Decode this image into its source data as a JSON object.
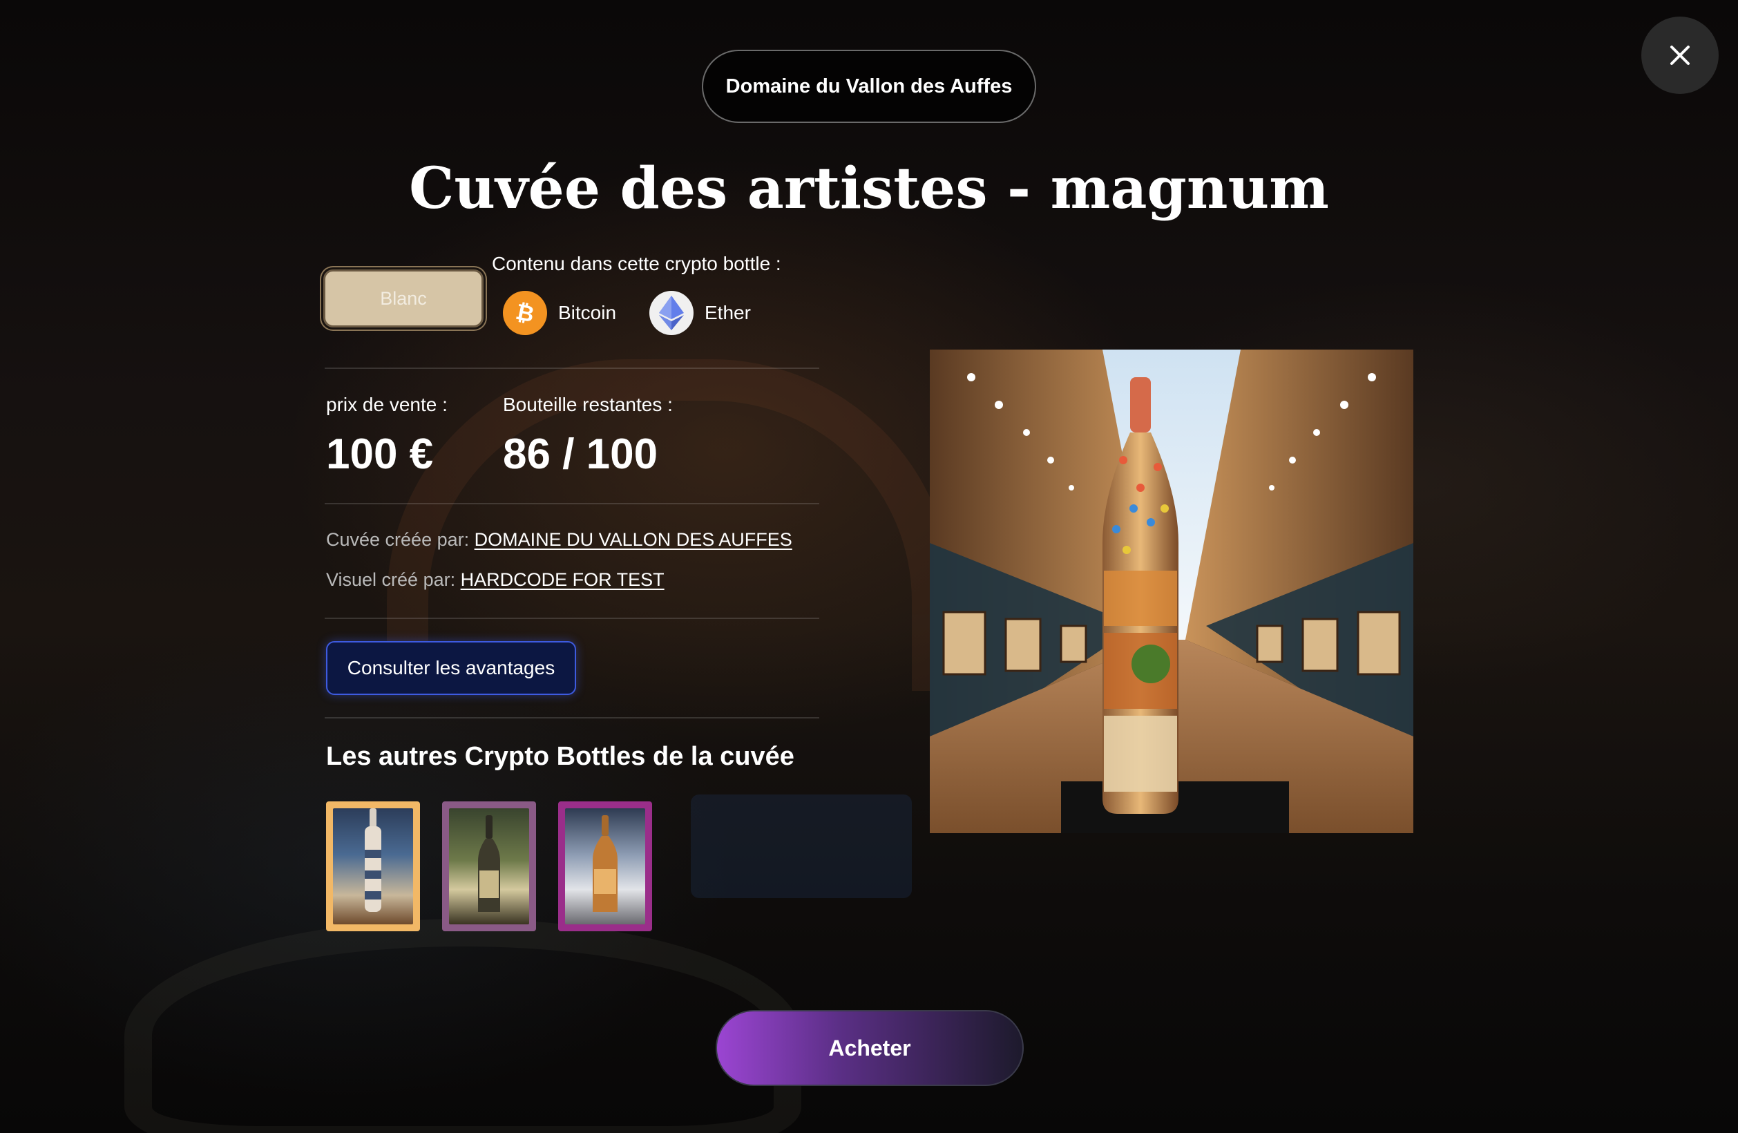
{
  "header": {
    "producer_label": "Domaine du Vallon des Auffes",
    "title": "Cuvée des artistes - magnum"
  },
  "close_button": {
    "icon": "close-icon"
  },
  "variant": {
    "selected_label": "Blanc"
  },
  "crypto": {
    "label": "Contenu dans cette crypto bottle :",
    "items": [
      {
        "name": "Bitcoin",
        "icon": "bitcoin-icon",
        "color": "#f39321"
      },
      {
        "name": "Ether",
        "icon": "ethereum-icon",
        "color": "#627eea"
      }
    ]
  },
  "stats": {
    "price_label": "prix de vente :",
    "price_value": "100 €",
    "remaining_label": "Bouteille restantes :",
    "remaining_value": "86 / 100"
  },
  "credits": {
    "cuvee_prefix": "Cuvée créée par:",
    "cuvee_link": "DOMAINE DU VALLON DES AUFFES",
    "visual_prefix": "Visuel créé par:",
    "visual_link": "HARDCODE FOR TEST"
  },
  "advantages_button": {
    "label": "Consulter les avantages"
  },
  "other_bottles": {
    "title": "Les autres Crypto Bottles de la cuvée",
    "items": [
      {
        "frame_color": "#f2b866",
        "selected": true
      },
      {
        "frame_color": "#8a5a86",
        "selected": false
      },
      {
        "frame_color": "#9a2e8a",
        "selected": false
      }
    ]
  },
  "buy_button": {
    "label": "Acheter"
  },
  "colors": {
    "background": "#0b0908",
    "accent_purple": "#9b45d2",
    "accent_blue": "#3e5be0",
    "variant_beige": "#d6c5a6"
  }
}
